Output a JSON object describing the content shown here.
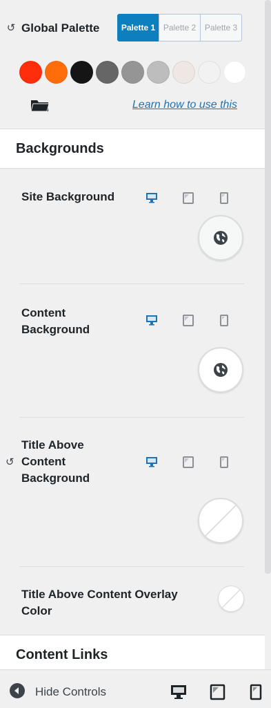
{
  "global_palette": {
    "title": "Global Palette",
    "tabs": [
      "Palette 1",
      "Palette 2",
      "Palette 3"
    ],
    "active_tab": 0,
    "swatches": [
      "#ff2d0b",
      "#ff6d0a",
      "#151515",
      "#666666",
      "#959595",
      "#bdbdbd",
      "#efe7e3",
      "#f2f2f2",
      "#ffffff"
    ],
    "learn_link": "Learn how to use this"
  },
  "backgrounds": {
    "header": "Backgrounds",
    "site_background": {
      "label": "Site Background"
    },
    "content_background": {
      "label_1": "Content",
      "label_2": "Background"
    },
    "title_above": {
      "label_1": "Title Above",
      "label_2": "Content",
      "label_3": "Background"
    },
    "overlay": {
      "label_1": "Title Above Content Overlay",
      "label_2": "Color"
    }
  },
  "content_links": {
    "header": "Content Links"
  },
  "footer": {
    "hide_label": "Hide Controls"
  },
  "colors": {
    "accent": "#0d7fbf",
    "device_active": "#2271b1",
    "device_inactive": "#8c8f94"
  }
}
